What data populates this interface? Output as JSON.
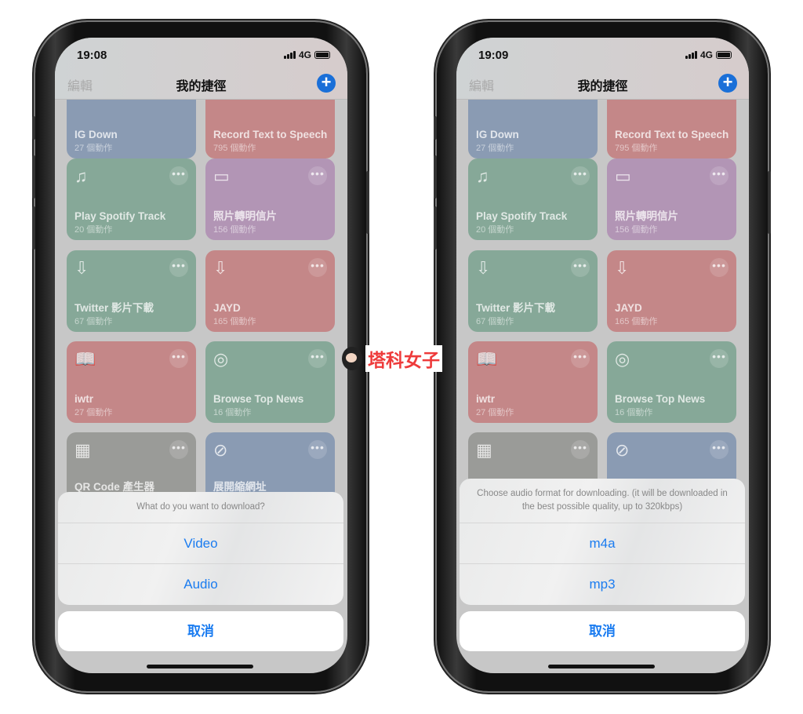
{
  "phones": [
    {
      "time": "19:08",
      "network": "4G",
      "nav": {
        "edit": "編輯",
        "title": "我的捷徑"
      },
      "sheet": {
        "message": "What do you want to download?",
        "options": [
          "Video",
          "Audio"
        ],
        "cancel": "取消"
      }
    },
    {
      "time": "19:09",
      "network": "4G",
      "nav": {
        "edit": "編輯",
        "title": "我的捷徑"
      },
      "sheet": {
        "message": "Choose audio format for downloading. (it will be downloaded in the best possible quality, up to 320kbps)",
        "options": [
          "m4a",
          "mp3"
        ],
        "cancel": "取消"
      }
    }
  ],
  "shortcuts": [
    {
      "name": "IG Down",
      "count": "27 個動作",
      "color": "#8a9bb3",
      "icon": ""
    },
    {
      "name": "Record Text to Speech",
      "count": "795 個動作",
      "color": "#c48788",
      "icon": ""
    },
    {
      "name": "Play Spotify Track",
      "count": "20 個動作",
      "color": "#86a898",
      "icon": "music-note-icon"
    },
    {
      "name": "照片轉明信片",
      "count": "156 個動作",
      "color": "#b295b5",
      "icon": "tv-icon"
    },
    {
      "name": "Twitter 影片下載",
      "count": "67 個動作",
      "color": "#86a898",
      "icon": "download-icon"
    },
    {
      "name": "JAYD",
      "count": "165 個動作",
      "color": "#c48788",
      "icon": "download-icon"
    },
    {
      "name": "iwtr",
      "count": "27 個動作",
      "color": "#c48788",
      "icon": "book-icon"
    },
    {
      "name": "Browse Top News",
      "count": "16 個動作",
      "color": "#86a898",
      "icon": "globe-icon"
    },
    {
      "name": "QR Code 產生器",
      "count": "",
      "color": "#9a9b98",
      "icon": "qr-code-icon"
    },
    {
      "name": "展開縮網址",
      "count": "",
      "color": "#8a9bb3",
      "icon": "link-icon"
    }
  ],
  "watermark": "塔科女子"
}
